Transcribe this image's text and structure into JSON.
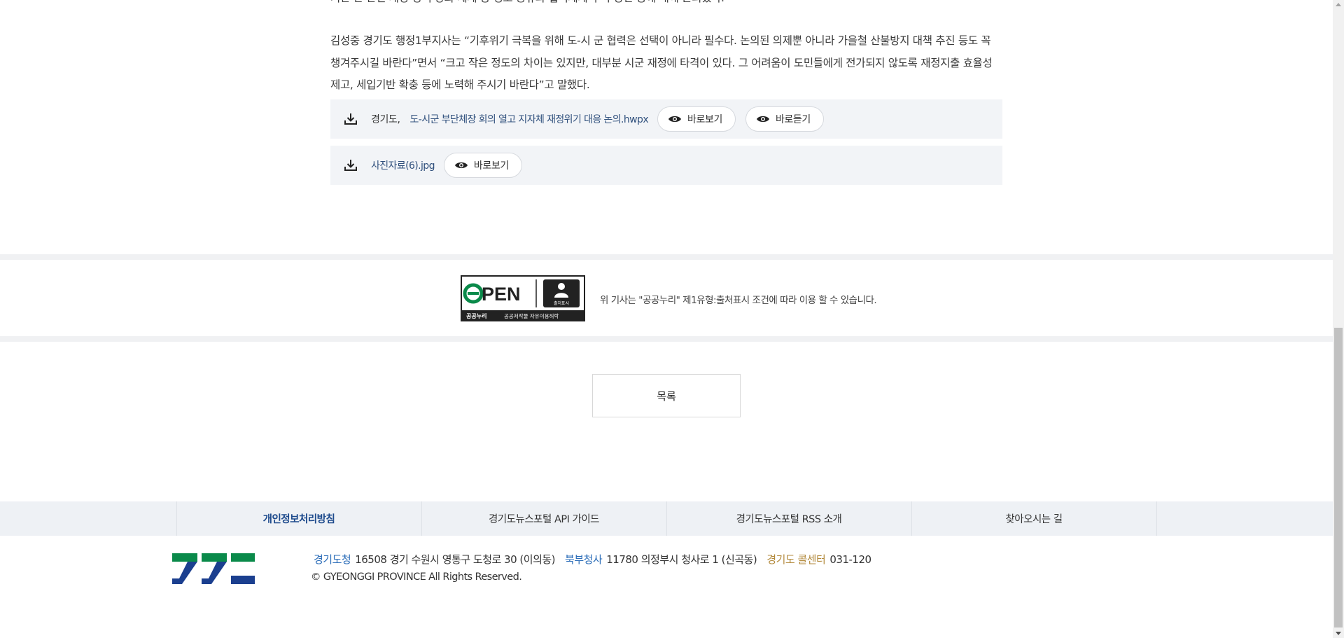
{
  "article": {
    "cut_paragraph": "기관 간 관련 재정 정책 강화 체계 등 정보 공유와 협력체계 구축 방안 등에 대해 논의했다.",
    "paragraph": "김성중 경기도 행정1부지사는 “기후위기 극복을 위해 도-시 군 협력은 선택이 아니라 필수다. 논의된 의제뿐 아니라 가을철 산불방지 대책 추진 등도 꼭 챙겨주시길 바란다”면서 “크고 작은 정도의 차이는 있지만, 대부분 시군 재정에 타격이 있다. 그 어려움이 도민들에게 전가되지 않도록 재정지출 효율성 제고, 세입기반 확충 등에 노력해 주시기 바란다”고 말했다."
  },
  "attachments": [
    {
      "prefix": "경기도,",
      "name": "도-시군 부단체장 회의 열고 지자체 재정위기 대응 논의.hwpx",
      "view_label": "바로보기",
      "listen_label": "바로듣기"
    },
    {
      "name": "사진자료(6).jpg",
      "view_label": "바로보기"
    }
  ],
  "license": {
    "logo_text": "OPEN",
    "badge_text": "출처표시",
    "bar_left": "공공누리",
    "bar_right": "공공저작물 자유이용허락",
    "notice": "위 기사는 \"공공누리\" 제1유형:출처표시 조건에 따라 이용 할 수 있습니다."
  },
  "list_button": "목록",
  "footer": {
    "nav": [
      "개인정보처리방침",
      "경기도뉴스포털 API 가이드",
      "경기도뉴스포털 RSS 소개",
      "찾아오시는 길"
    ],
    "address": {
      "office1_label": "경기도청",
      "office1_addr": "16508 경기 수원시 영통구 도청로 30 (이의동)",
      "office2_label": "북부청사",
      "office2_addr": "11780 의정부시 청사로 1 (신곡동)",
      "call_label": "경기도 콜센터",
      "call_number": "031-120"
    },
    "copyright": "© GYEONGGI PROVINCE All Rights Reserved."
  },
  "colors": {
    "accent_blue": "#1d4a8c",
    "link_blue": "#2a6cb8",
    "call_gold": "#b38a3c",
    "logo_green": "#0a8a4a",
    "logo_navy": "#1b3f8f"
  }
}
